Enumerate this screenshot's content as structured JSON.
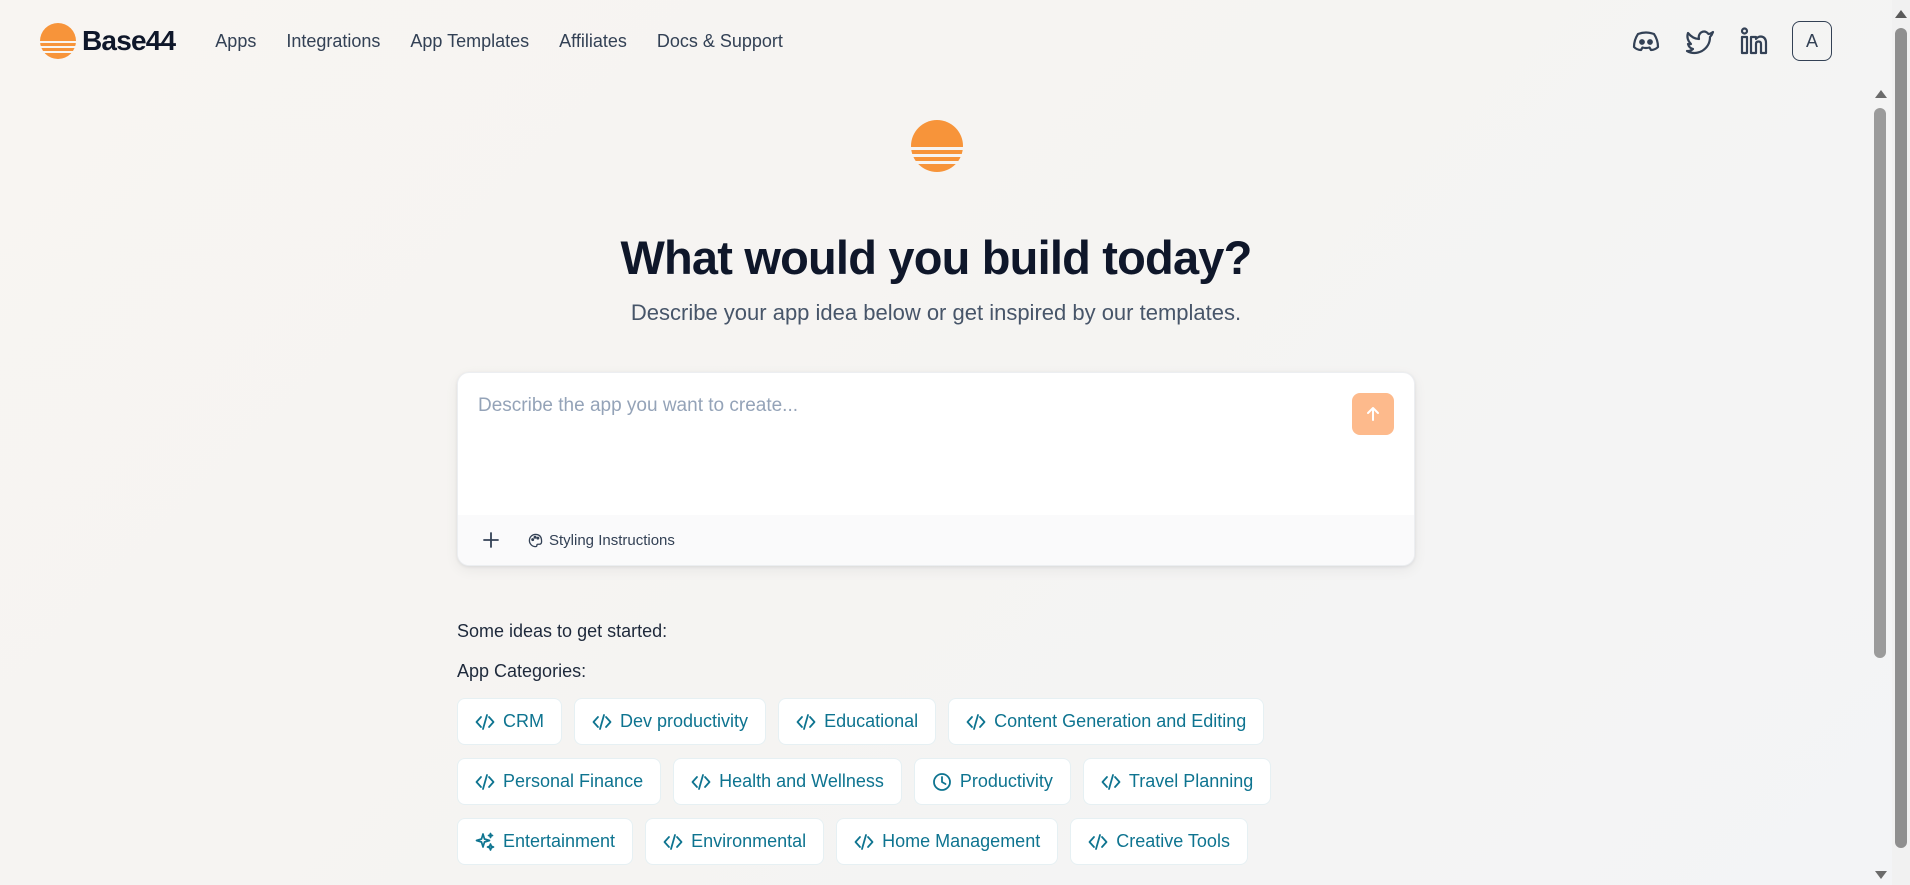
{
  "header": {
    "logo_text": "Base44",
    "nav": [
      {
        "label": "Apps"
      },
      {
        "label": "Integrations"
      },
      {
        "label": "App Templates"
      },
      {
        "label": "Affiliates"
      },
      {
        "label": "Docs & Support"
      }
    ],
    "social_icons": [
      "discord-icon",
      "twitter-icon",
      "linkedin-icon"
    ],
    "avatar_initial": "A"
  },
  "hero": {
    "title": "What would you build today?",
    "subtitle": "Describe your app idea below or get inspired by our templates."
  },
  "prompt": {
    "value": "",
    "placeholder": "Describe the app you want to create...",
    "styling_label": "Styling Instructions"
  },
  "ideas": {
    "heading": "Some ideas to get started:",
    "categories_heading": "App Categories:",
    "rows": [
      [
        {
          "label": "CRM",
          "icon": "code-icon"
        },
        {
          "label": "Dev productivity",
          "icon": "code-icon"
        },
        {
          "label": "Educational",
          "icon": "code-icon"
        },
        {
          "label": "Content Generation and Editing",
          "icon": "code-icon"
        }
      ],
      [
        {
          "label": "Personal Finance",
          "icon": "code-icon"
        },
        {
          "label": "Health and Wellness",
          "icon": "code-icon"
        },
        {
          "label": "Productivity",
          "icon": "clock-icon"
        },
        {
          "label": "Travel Planning",
          "icon": "code-icon"
        }
      ],
      [
        {
          "label": "Entertainment",
          "icon": "sparkles-icon"
        },
        {
          "label": "Environmental",
          "icon": "code-icon"
        },
        {
          "label": "Home Management",
          "icon": "code-icon"
        },
        {
          "label": "Creative Tools",
          "icon": "code-icon"
        }
      ]
    ]
  },
  "colors": {
    "brand_orange": "#f7943a",
    "send_button": "#fdba8c",
    "chip_text": "#0e7490",
    "title_text": "#0f172a"
  }
}
